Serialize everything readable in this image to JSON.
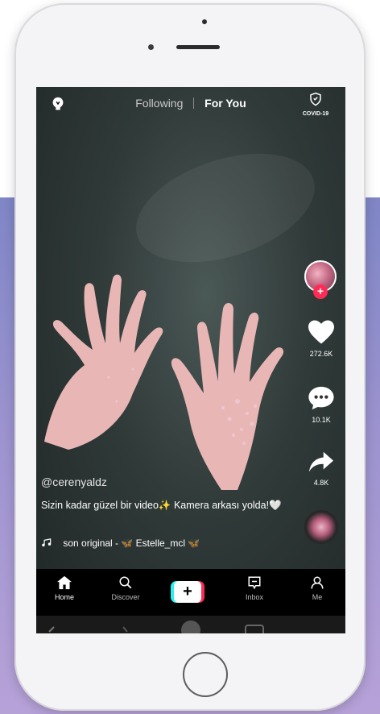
{
  "topbar": {
    "tab_following": "Following",
    "tab_for_you": "For You",
    "covid_label": "COVID-19"
  },
  "rail": {
    "likes": "272.6K",
    "comments": "10.1K",
    "shares": "4.8K"
  },
  "post": {
    "username": "@cerenyaldz",
    "description": "Sizin kadar güzel bir video✨ Kamera arkası yolda!🤍",
    "sound": "son original - 🦋 Estelle_mcl 🦋"
  },
  "nav": {
    "home": "Home",
    "discover": "Discover",
    "create": "+",
    "inbox": "Inbox",
    "me": "Me"
  },
  "colors": {
    "accent_red": "#fe2c55",
    "accent_cyan": "#25f4ee",
    "background_band": "#9c93cf"
  },
  "icons": [
    "lightbulb-icon",
    "shield-icon",
    "heart-icon",
    "comment-icon",
    "share-icon",
    "music-note-icon",
    "home-icon",
    "search-icon",
    "plus-icon",
    "inbox-icon",
    "profile-icon"
  ]
}
